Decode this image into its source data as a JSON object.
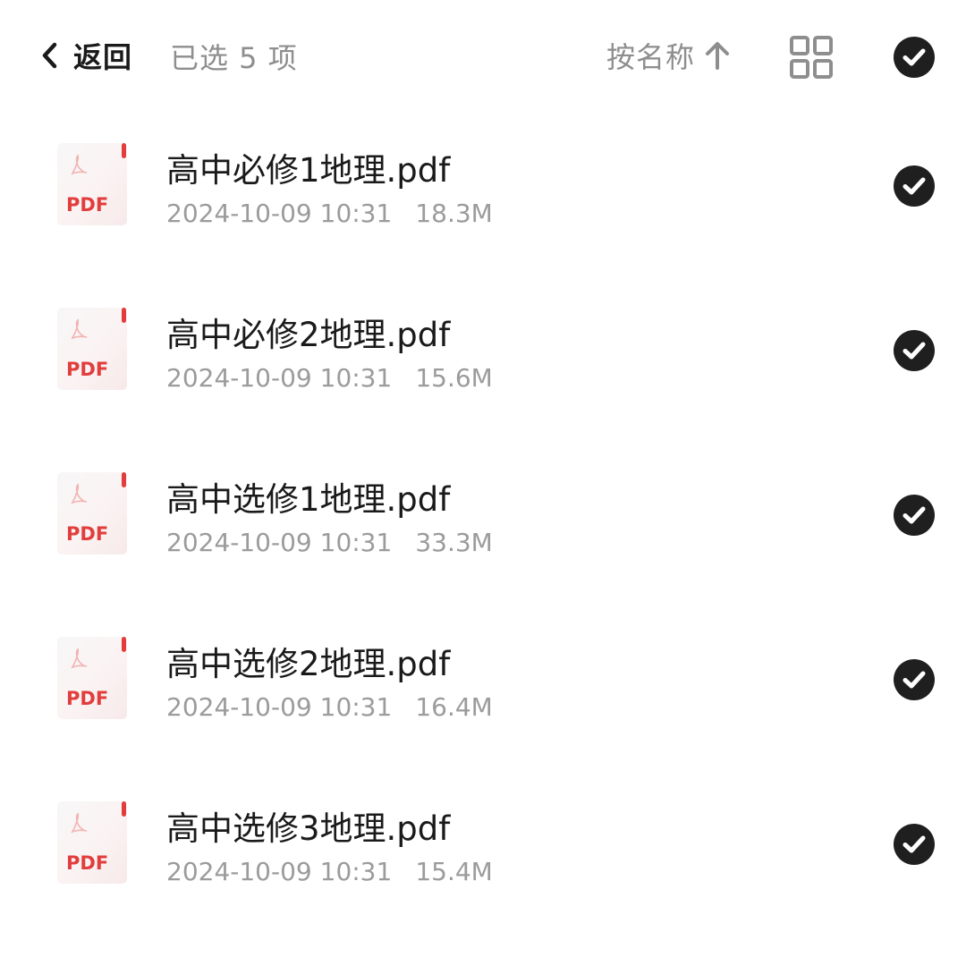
{
  "header": {
    "back_label": "返回",
    "selected_text": "已选 5 项",
    "sort_label": "按名称",
    "icons": {
      "back": "chevron-left-icon",
      "sort_direction": "arrow-up-icon",
      "view_toggle": "grid-view-icon",
      "select_all": "checkmark-circle-icon"
    },
    "select_all_checked": true
  },
  "files": [
    {
      "name": "高中必修1地理.pdf",
      "date": "2024-10-09 10:31",
      "size": "18.3M",
      "type_label": "PDF",
      "checked": true
    },
    {
      "name": "高中必修2地理.pdf",
      "date": "2024-10-09 10:31",
      "size": "15.6M",
      "type_label": "PDF",
      "checked": true
    },
    {
      "name": "高中选修1地理.pdf",
      "date": "2024-10-09 10:31",
      "size": "33.3M",
      "type_label": "PDF",
      "checked": true
    },
    {
      "name": "高中选修2地理.pdf",
      "date": "2024-10-09 10:31",
      "size": "16.4M",
      "type_label": "PDF",
      "checked": true
    },
    {
      "name": "高中选修3地理.pdf",
      "date": "2024-10-09 10:31",
      "size": "15.4M",
      "type_label": "PDF",
      "checked": true
    }
  ],
  "colors": {
    "pdf_red": "#e23d3d",
    "check_fill": "#1f1f1f",
    "secondary_text": "#8e8e8e"
  }
}
